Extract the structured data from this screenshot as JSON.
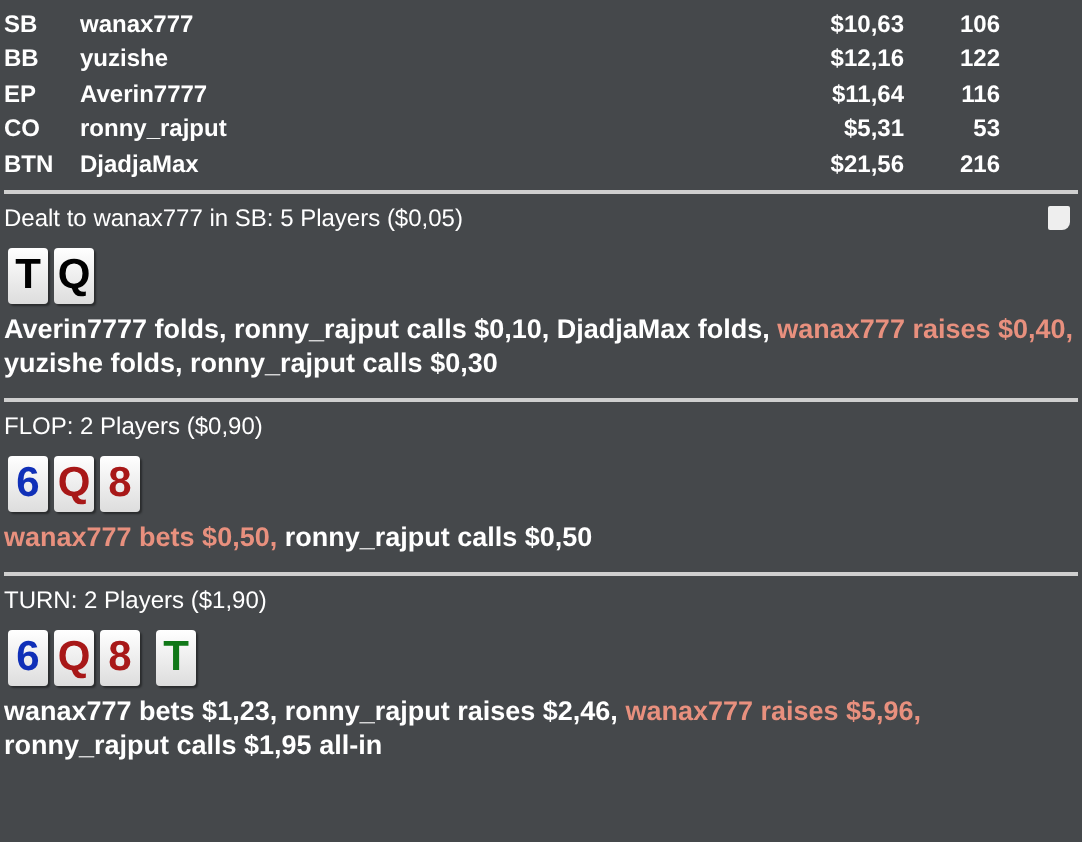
{
  "players": [
    {
      "position": "SB",
      "name": "wanax777",
      "stack": "$10,63",
      "bb": "106"
    },
    {
      "position": "BB",
      "name": "yuzishe",
      "stack": "$12,16",
      "bb": "122"
    },
    {
      "position": "EP",
      "name": "Averin7777",
      "stack": "$11,64",
      "bb": "116"
    },
    {
      "position": "CO",
      "name": "ronny_rajput",
      "stack": "$5,31",
      "bb": "53"
    },
    {
      "position": "BTN",
      "name": "DjadjaMax",
      "stack": "$21,56",
      "bb": "216"
    }
  ],
  "streets": [
    {
      "header": "Dealt to wanax777 in SB: 5 Players ($0,05)",
      "note": true,
      "cards": [
        {
          "rank": "T",
          "color": "#000000"
        },
        {
          "rank": "Q",
          "color": "#000000"
        }
      ],
      "actions": [
        {
          "text": "Averin7777 folds, ",
          "hero": false
        },
        {
          "text": "ronny_rajput calls $0,10, ",
          "hero": false
        },
        {
          "text": "DjadjaMax folds, ",
          "hero": false
        },
        {
          "text": "wanax777 raises $0,40,",
          "hero": true
        },
        {
          "text": " yuzishe folds, ",
          "hero": false
        },
        {
          "text": "ronny_rajput calls $0,30",
          "hero": false
        }
      ]
    },
    {
      "header": "FLOP: 2 Players ($0,90)",
      "note": false,
      "cards": [
        {
          "rank": "6",
          "color": "#1030b8"
        },
        {
          "rank": "Q",
          "color": "#a81818"
        },
        {
          "rank": "8",
          "color": "#a81818"
        }
      ],
      "actions": [
        {
          "text": "wanax777 bets $0,50,",
          "hero": true
        },
        {
          "text": " ronny_rajput calls $0,50",
          "hero": false
        }
      ]
    },
    {
      "header": "TURN: 2 Players ($1,90)",
      "note": false,
      "cards": [
        {
          "rank": "6",
          "color": "#1030b8"
        },
        {
          "rank": "Q",
          "color": "#a81818"
        },
        {
          "rank": "8",
          "color": "#a81818"
        },
        {
          "rank": "T",
          "color": "#107818"
        }
      ],
      "actions": [
        {
          "text": "wanax777 bets $1,23, ",
          "hero": false
        },
        {
          "text": "ronny_rajput raises $2,46, ",
          "hero": false
        },
        {
          "text": "wanax777 raises $5,96,",
          "hero": true
        },
        {
          "text": " ronny_rajput calls $1,95 all-in",
          "hero": false
        }
      ]
    }
  ]
}
